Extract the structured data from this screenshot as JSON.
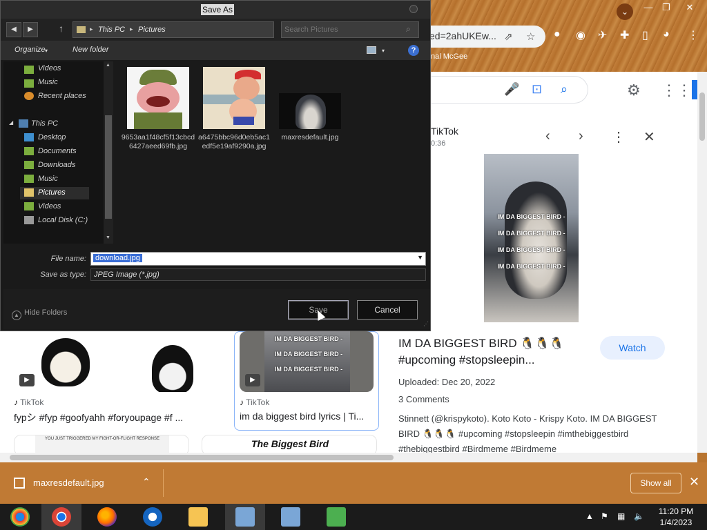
{
  "browser": {
    "omnibox_text": "ed=2ahUKEw...",
    "bookmark": "nal McGee"
  },
  "side_panel": {
    "source": "TikTok",
    "time": "0:36",
    "overlay_lines": [
      "IM DA BIGGEST BIRD -",
      "IM DA BIGGEST BIRD -",
      "IM DA BIGGEST BIRD -",
      "IM DA BIGGEST BIRD -"
    ],
    "title": "IM DA BIGGEST BIRD 🐧🐧🐧 #upcoming #stopsleepin...",
    "watch_label": "Watch",
    "uploaded": "Uploaded: Dec 20, 2022",
    "comments": "3 Comments",
    "description": "Stinnett (@krispykoto). Koto Koto - Krispy Koto. IM DA BIGGEST BIRD 🐧🐧🐧 #upcoming #stopsleepin #imthebiggestbird #thebiggestbird #Birdmeme #Birdmeme"
  },
  "results": [
    {
      "source": "TikTok",
      "title": "fypシ #fyp #goofyahh #foryoupage #f ..."
    },
    {
      "source": "TikTok",
      "title": "im da biggest bird lyrics | Ti..."
    }
  ],
  "thumb_overlay": [
    "IM DA BIGGEST BIRD -",
    "IM DA BIGGEST BIRD -",
    "IM DA BIGGEST BIRD -"
  ],
  "lower_cards": {
    "meme_text": "YOU JUST TRIGGERED MY FIGHT-OR-FLIGHT RESPONSE",
    "biggest_bird": "The Biggest Bird"
  },
  "downloads": {
    "file": "maxresdefault.jpg",
    "show_all": "Show all"
  },
  "taskbar": {
    "time": "11:20 PM",
    "date": "1/4/2023"
  },
  "dialog": {
    "title": "Save As",
    "breadcrumb": [
      "This PC",
      "Pictures"
    ],
    "search_placeholder": "Search Pictures",
    "organize": "Organize",
    "new_folder": "New folder",
    "nav_items": [
      {
        "label": "Videos"
      },
      {
        "label": "Music"
      },
      {
        "label": "Recent places"
      },
      {
        "label": "This PC"
      },
      {
        "label": "Desktop"
      },
      {
        "label": "Documents"
      },
      {
        "label": "Downloads"
      },
      {
        "label": "Music"
      },
      {
        "label": "Pictures"
      },
      {
        "label": "Videos"
      },
      {
        "label": "Local Disk (C:)"
      }
    ],
    "files": [
      {
        "name": "9653aa1f48cf5f13cbcd6427aeed69fb.jpg"
      },
      {
        "name": "a6475bbc96d0eb5ac1edf5e19af9290a.jpg"
      },
      {
        "name": "maxresdefault.jpg"
      }
    ],
    "file_name_label": "File name:",
    "file_name_value": "download.jpg",
    "save_type_label": "Save as type:",
    "save_type_value": "JPEG Image (*.jpg)",
    "hide_folders": "Hide Folders",
    "save_label": "Save",
    "cancel_label": "Cancel"
  }
}
